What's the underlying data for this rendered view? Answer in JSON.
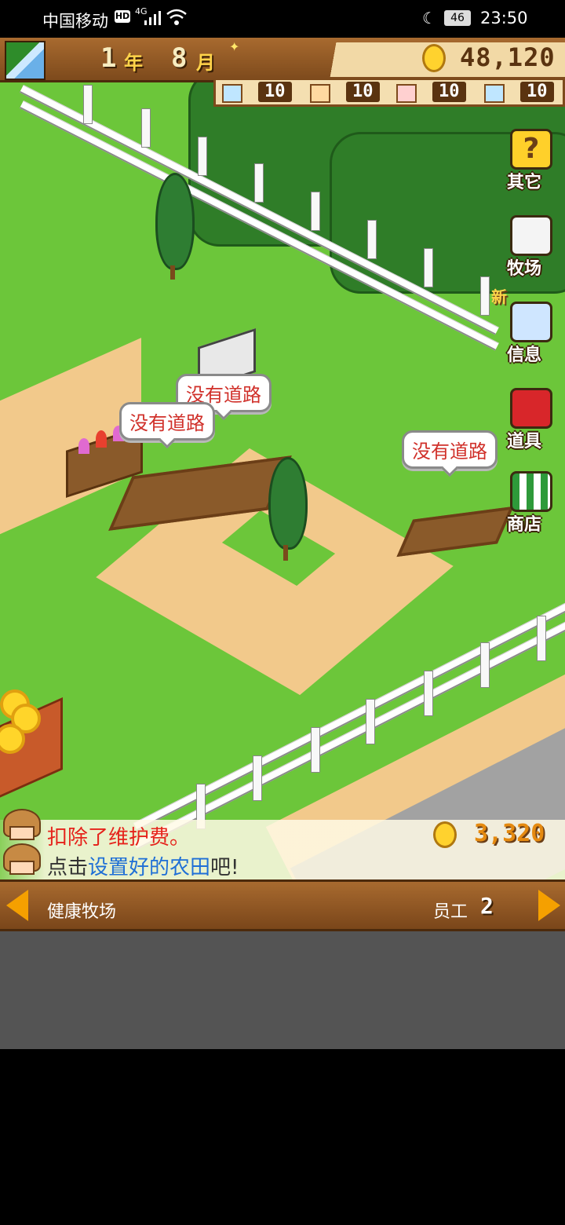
{
  "status_bar": {
    "carrier": "中国移动",
    "hd": "HD",
    "network": "4G",
    "battery": "46",
    "time": "23:50"
  },
  "top_bar": {
    "year": "1",
    "year_unit": "年",
    "month": "8",
    "month_unit": "月",
    "money": "48,120"
  },
  "resources": [
    {
      "icon": "flower-seed-icon",
      "value": "10"
    },
    {
      "icon": "carrot-seed-icon",
      "value": "10"
    },
    {
      "icon": "tomato-seed-icon",
      "value": "10"
    },
    {
      "icon": "cow-feed-icon",
      "value": "10"
    }
  ],
  "bubbles": [
    "没有道路",
    "没有道路",
    "没有道路"
  ],
  "side_menu": {
    "other": "其它",
    "ranch": "牧场",
    "new_badge": "新",
    "info": "信息",
    "items": "道具",
    "shop": "商店"
  },
  "messages": {
    "line1": "扣除了维护费。",
    "line2_pre": "点击",
    "line2_highlight": "设置好的农田",
    "line2_post": "吧!",
    "fee": "3,320"
  },
  "bottom_bar": {
    "farm_name": "健康牧场",
    "staff_label": "员工",
    "staff_count": "2"
  },
  "colors": {
    "grass": "#6cc63a",
    "wood": "#a86a2f",
    "alert_red": "#e5231b",
    "highlight_blue": "#1f6fd6"
  }
}
